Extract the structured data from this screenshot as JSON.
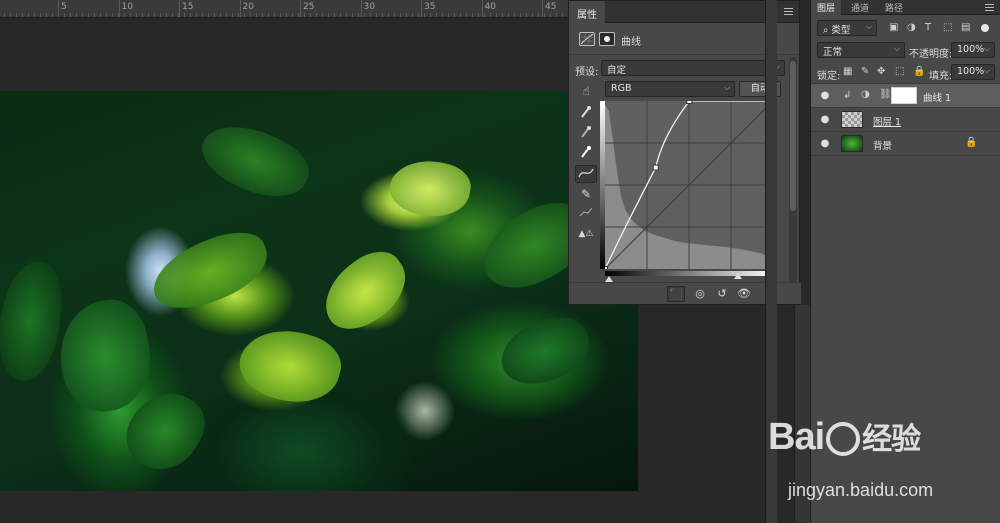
{
  "ruler": {
    "labels": [
      "5",
      "10",
      "15",
      "20",
      "25",
      "30",
      "35",
      "40",
      "45"
    ]
  },
  "properties": {
    "tab_label": "属性",
    "adjust_title": "曲线",
    "preset_label": "预设:",
    "preset_value": "自定",
    "channel_value": "RGB",
    "auto_button": "自动"
  },
  "layers": {
    "tabs": [
      "图层",
      "通道",
      "路径"
    ],
    "filter_value": "类型",
    "blend_mode": "正常",
    "opacity_label": "不透明度:",
    "opacity_value": "100%",
    "lock_label": "锁定:",
    "fill_label": "填充:",
    "fill_value": "100%",
    "items": [
      {
        "name": "曲线 1"
      },
      {
        "name": "图层 1"
      },
      {
        "name": "背景"
      }
    ]
  },
  "watermark": {
    "brand": "Bai",
    "brand2": "经验",
    "url": "jingyan.baidu.com"
  },
  "curve": {
    "points": [
      [
        0,
        0
      ],
      [
        77,
        154
      ],
      [
        128,
        255
      ]
    ]
  },
  "icons": {
    "eye": "eye-icon",
    "lock": "lock-icon",
    "trash": "trash-icon"
  },
  "colors": {
    "panel": "#484848",
    "dark": "#282828",
    "selected_layer": "#5e5e5e"
  }
}
